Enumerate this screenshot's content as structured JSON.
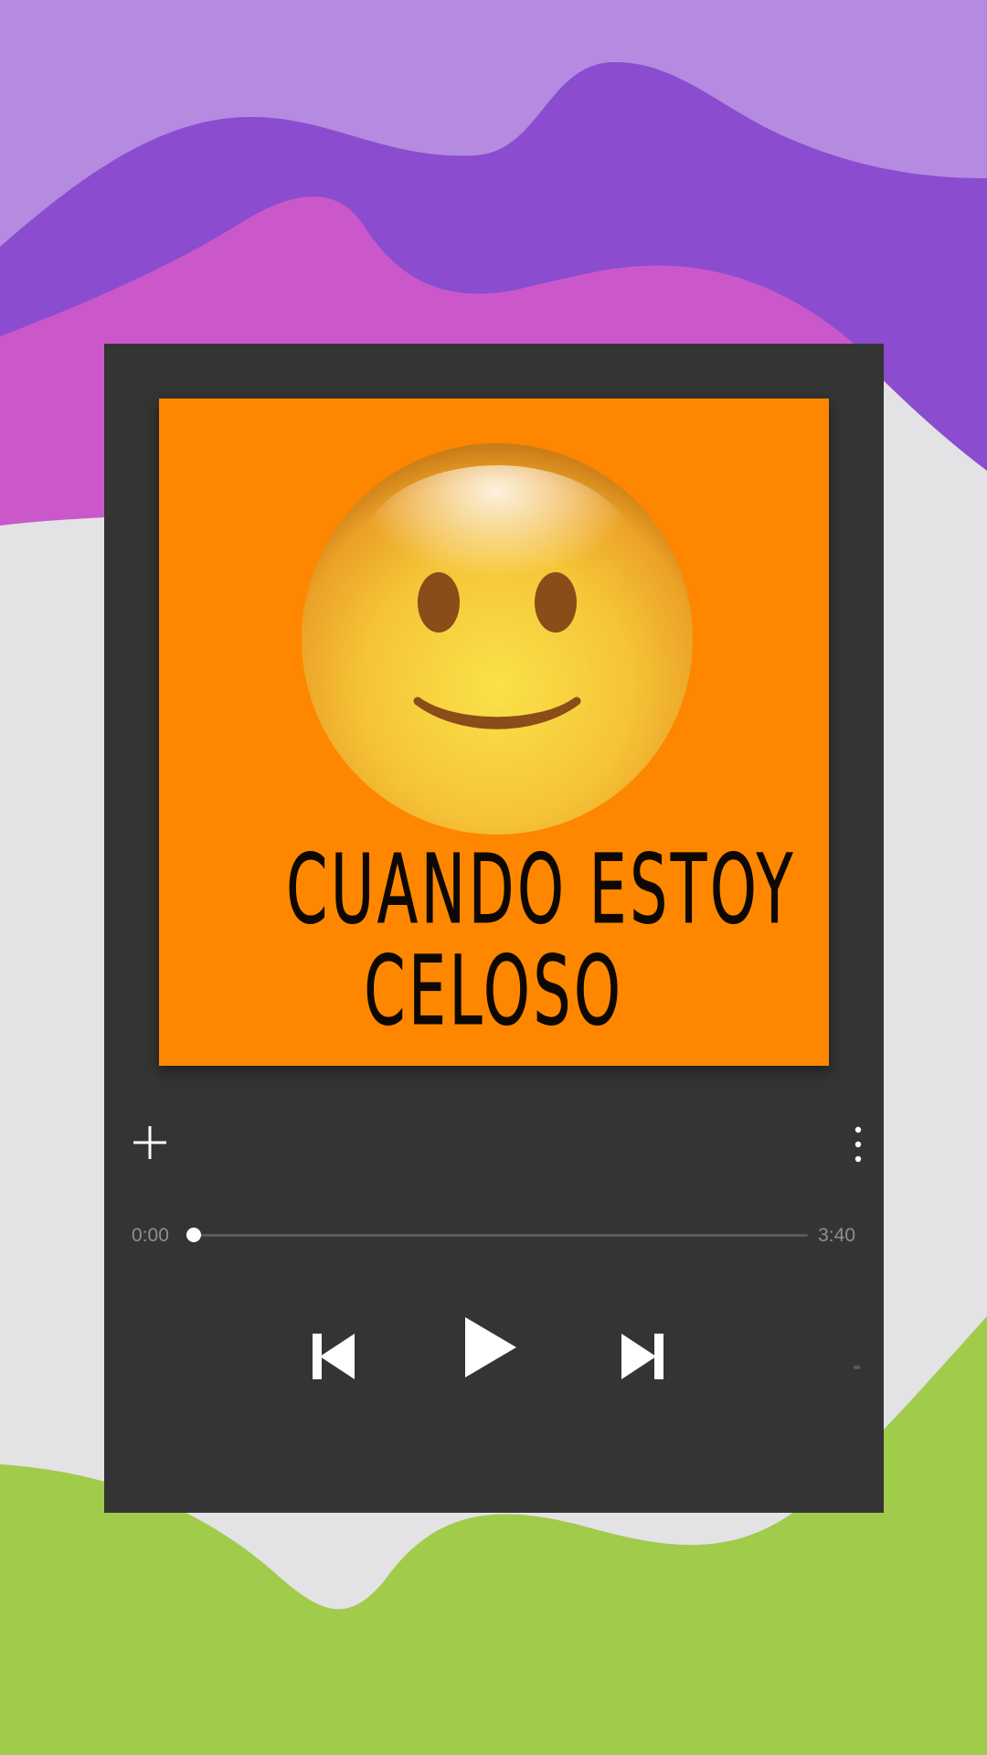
{
  "background": {
    "colors": {
      "lavender": "#b48be0",
      "purple": "#8c4ccf",
      "magenta": "#cb58cb",
      "grey": "#e3e3e6",
      "green": "#a1cb4a"
    }
  },
  "player": {
    "background_color": "#343434",
    "artwork": {
      "background_color": "#ff8700",
      "emoji": "slightly-smiling-face",
      "title_line_1": "CUANDO ESTOY",
      "title_line_2": "CELOSO"
    },
    "actions": {
      "add_icon": "plus-icon",
      "more_icon": "more-vertical-icon"
    },
    "progress": {
      "current_time": "0:00",
      "total_time": "3:40",
      "fraction": 0.0
    },
    "controls": {
      "previous_icon": "skip-previous-icon",
      "play_icon": "play-icon",
      "next_icon": "skip-next-icon"
    }
  }
}
